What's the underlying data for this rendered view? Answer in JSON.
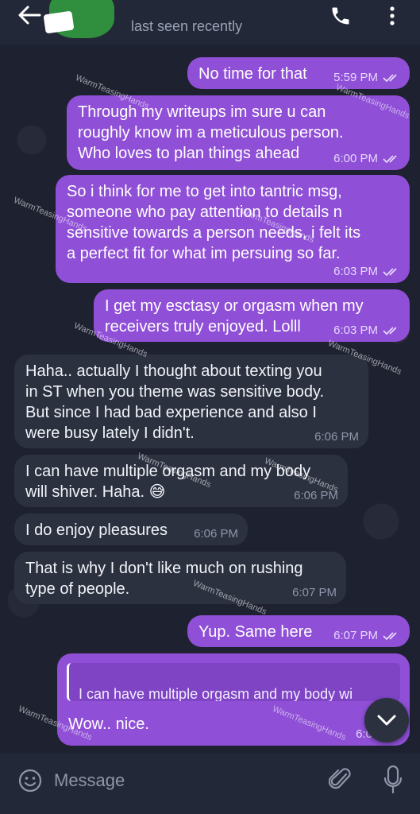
{
  "header": {
    "contact_name": "",
    "status": "last seen recently"
  },
  "messages": [
    {
      "dir": "out",
      "text": "No time for that",
      "time": "5:59 PM"
    },
    {
      "dir": "out",
      "text": "Through my writeups im sure u can\nroughly know im a meticulous person.\nWho loves to plan things ahead",
      "time": "6:00 PM"
    },
    {
      "dir": "out",
      "text": "So i think for me to get into tantric msg,\nsomeone who pay attention to details n\nsensitive towards a person needs, i felt its\na perfect fit for what im persuing so far.",
      "time": "6:03 PM"
    },
    {
      "dir": "out",
      "text": "I get my esctasy or orgasm when my\nreceivers truly enjoyed. Lolll",
      "time": "6:03 PM"
    },
    {
      "dir": "in",
      "text": "Haha.. actually I thought about texting you\nin ST when you theme was sensitive body.\nBut since I had bad experience and also I\nwere busy lately I didn't.",
      "time": "6:06 PM"
    },
    {
      "dir": "in",
      "text": "I can have multiple orgasm and my body\nwill shiver. Haha. 😅",
      "time": "6:06 PM"
    },
    {
      "dir": "in",
      "text": "I do enjoy pleasures",
      "time": "6:06 PM"
    },
    {
      "dir": "in",
      "text": "That is why I don't like much on rushing\ntype of people.",
      "time": "6:07 PM"
    },
    {
      "dir": "out",
      "text": "Yup. Same here",
      "time": "6:07 PM"
    },
    {
      "dir": "out",
      "quote": "I can have multiple orgasm and my body wi",
      "text": "Wow.. nice.",
      "time": "6:07 PM"
    }
  ],
  "watermark": "WarmTeasingHands",
  "composer": {
    "placeholder": "Message"
  },
  "colors": {
    "outgoing_bubble": "#8f4fd6",
    "incoming_bubble": "#2c3140",
    "chat_background": "#1e2130",
    "header": "#232838"
  },
  "icons": {
    "back": "arrow-left-icon",
    "call": "phone-icon",
    "menu": "more-vertical-icon",
    "scroll": "chevron-down-icon",
    "emoji": "smiley-icon",
    "attach": "paperclip-icon",
    "mic": "microphone-icon",
    "read": "double-check-icon"
  }
}
